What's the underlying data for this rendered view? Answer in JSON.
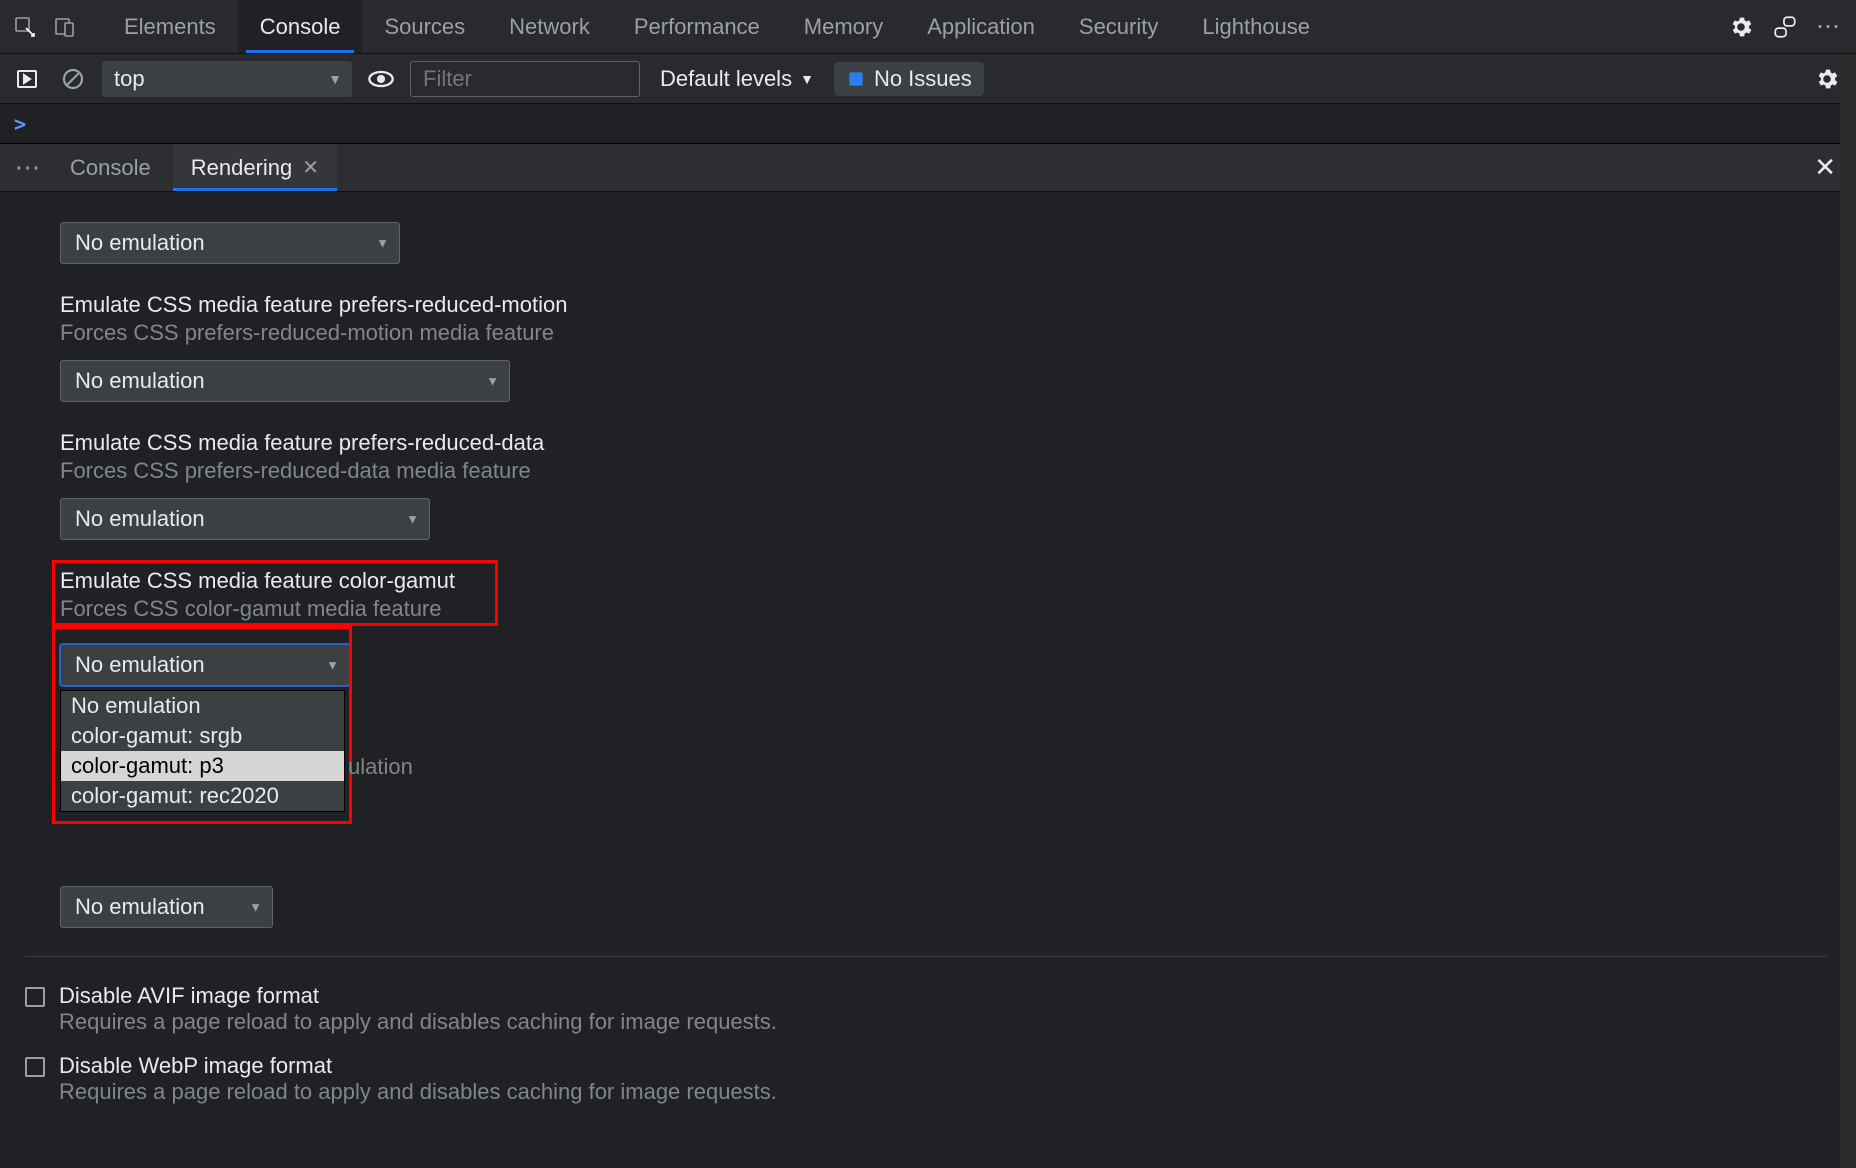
{
  "topTabs": {
    "items": [
      "Elements",
      "Console",
      "Sources",
      "Network",
      "Performance",
      "Memory",
      "Application",
      "Security",
      "Lighthouse"
    ],
    "activeIndex": 1
  },
  "consoleToolbar": {
    "context": "top",
    "filterPlaceholder": "Filter",
    "levels": "Default levels",
    "issues": "No Issues"
  },
  "promptSymbol": ">",
  "drawer": {
    "tabs": [
      "Console",
      "Rendering"
    ],
    "activeIndex": 1
  },
  "rendering": {
    "sections": [
      {
        "id": "generic",
        "selectValue": "No emulation"
      },
      {
        "id": "prefers-reduced-motion",
        "title": "Emulate CSS media feature prefers-reduced-motion",
        "desc": "Forces CSS prefers-reduced-motion media feature",
        "selectValue": "No emulation"
      },
      {
        "id": "prefers-reduced-data",
        "title": "Emulate CSS media feature prefers-reduced-data",
        "desc": "Forces CSS prefers-reduced-data media feature",
        "selectValue": "No emulation"
      },
      {
        "id": "color-gamut",
        "title": "Emulate CSS media feature color-gamut",
        "desc": "Forces CSS color-gamut media feature",
        "selectValue": "No emulation",
        "options": [
          "No emulation",
          "color-gamut: srgb",
          "color-gamut: p3",
          "color-gamut: rec2020"
        ],
        "hoveredIndex": 2
      },
      {
        "id": "vision-partial",
        "partialText": "ulation",
        "selectValue": "No emulation"
      }
    ],
    "checkboxes": [
      {
        "id": "disable-avif",
        "title": "Disable AVIF image format",
        "desc": "Requires a page reload to apply and disables caching for image requests."
      },
      {
        "id": "disable-webp",
        "title": "Disable WebP image format",
        "desc": "Requires a page reload to apply and disables caching for image requests."
      }
    ]
  }
}
